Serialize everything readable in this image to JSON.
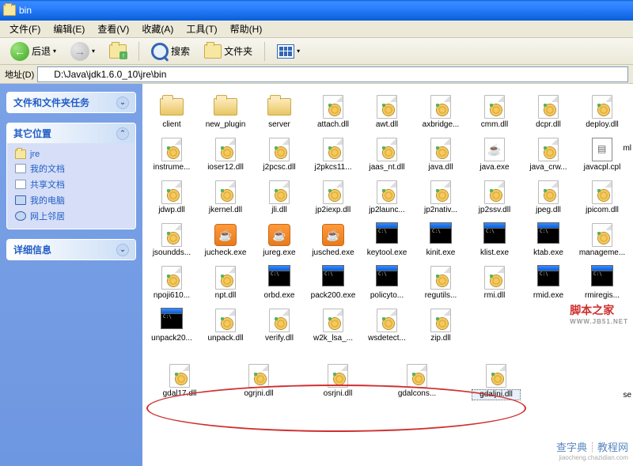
{
  "title": "bin",
  "menu": {
    "file": "文件(F)",
    "edit": "编辑(E)",
    "view": "查看(V)",
    "favorites": "收藏(A)",
    "tools": "工具(T)",
    "help": "帮助(H)"
  },
  "toolbar": {
    "back": "后退",
    "search": "搜索",
    "folders": "文件夹"
  },
  "address": {
    "label": "地址(D)",
    "path": "D:\\Java\\jdk1.6.0_10\\jre\\bin"
  },
  "sidebar": {
    "p1": {
      "title": "文件和文件夹任务"
    },
    "p2": {
      "title": "其它位置",
      "items": [
        {
          "label": "jre",
          "icon": "folder"
        },
        {
          "label": "我的文档",
          "icon": "doc"
        },
        {
          "label": "共享文档",
          "icon": "doc"
        },
        {
          "label": "我的电脑",
          "icon": "comp"
        },
        {
          "label": "网上邻居",
          "icon": "net"
        }
      ]
    },
    "p3": {
      "title": "详细信息"
    }
  },
  "files": [
    {
      "name": "client",
      "type": "folder"
    },
    {
      "name": "new_plugin",
      "type": "folder"
    },
    {
      "name": "server",
      "type": "folder"
    },
    {
      "name": "attach.dll",
      "type": "dll"
    },
    {
      "name": "awt.dll",
      "type": "dll"
    },
    {
      "name": "axbridge...",
      "type": "dll"
    },
    {
      "name": "cmm.dll",
      "type": "dll"
    },
    {
      "name": "dcpr.dll",
      "type": "dll"
    },
    {
      "name": "deploy.dll",
      "type": "dll"
    },
    {
      "name": "instrume...",
      "type": "dll"
    },
    {
      "name": "ioser12.dll",
      "type": "dll"
    },
    {
      "name": "j2pcsc.dll",
      "type": "dll"
    },
    {
      "name": "j2pkcs11...",
      "type": "dll"
    },
    {
      "name": "jaas_nt.dll",
      "type": "dll"
    },
    {
      "name": "java.dll",
      "type": "dll"
    },
    {
      "name": "java.exe",
      "type": "javap"
    },
    {
      "name": "java_crw...",
      "type": "dll"
    },
    {
      "name": "javacpl.cpl",
      "type": "cpl"
    },
    {
      "name": "jdwp.dll",
      "type": "dll"
    },
    {
      "name": "jkernel.dll",
      "type": "dll"
    },
    {
      "name": "jli.dll",
      "type": "dll"
    },
    {
      "name": "jp2iexp.dll",
      "type": "dll"
    },
    {
      "name": "jp2launc...",
      "type": "dll"
    },
    {
      "name": "jp2nativ...",
      "type": "dll"
    },
    {
      "name": "jp2ssv.dll",
      "type": "dll"
    },
    {
      "name": "jpeg.dll",
      "type": "dll"
    },
    {
      "name": "jpicom.dll",
      "type": "dll"
    },
    {
      "name": "jsoundds...",
      "type": "dll"
    },
    {
      "name": "jucheck.exe",
      "type": "java"
    },
    {
      "name": "jureg.exe",
      "type": "java"
    },
    {
      "name": "jusched.exe",
      "type": "java"
    },
    {
      "name": "keytool.exe",
      "type": "exe"
    },
    {
      "name": "kinit.exe",
      "type": "exe"
    },
    {
      "name": "klist.exe",
      "type": "exe"
    },
    {
      "name": "ktab.exe",
      "type": "exe"
    },
    {
      "name": "manageme...",
      "type": "dll"
    },
    {
      "name": "npoji610...",
      "type": "dll"
    },
    {
      "name": "npt.dll",
      "type": "dll"
    },
    {
      "name": "orbd.exe",
      "type": "exe"
    },
    {
      "name": "pack200.exe",
      "type": "exe"
    },
    {
      "name": "policyto...",
      "type": "exe"
    },
    {
      "name": "regutils...",
      "type": "dll"
    },
    {
      "name": "rmi.dll",
      "type": "dll"
    },
    {
      "name": "rmid.exe",
      "type": "exe"
    },
    {
      "name": "rmiregis...",
      "type": "exe"
    },
    {
      "name": "unpack20...",
      "type": "exe"
    },
    {
      "name": "unpack.dll",
      "type": "dll"
    },
    {
      "name": "verify.dll",
      "type": "dll"
    },
    {
      "name": "w2k_lsa_...",
      "type": "dll"
    },
    {
      "name": "wsdetect...",
      "type": "dll"
    },
    {
      "name": "zip.dll",
      "type": "dll"
    }
  ],
  "circled": [
    {
      "name": "gdal17.dll",
      "type": "dll"
    },
    {
      "name": "ogrjni.dll",
      "type": "dll"
    },
    {
      "name": "osrjni.dll",
      "type": "dll"
    },
    {
      "name": "gdalcons...",
      "type": "dll"
    },
    {
      "name": "gdaljni.dll",
      "type": "dll",
      "selected": true
    }
  ],
  "misc": {
    "ml": "ml",
    "se": "se"
  },
  "wm1": {
    "main": "脚本之家",
    "sub": "WWW.JB51.NET"
  },
  "wm2": {
    "main": "查字典",
    "sub": "jiaocheng.chazidian.com",
    "suffix": "教程网"
  }
}
